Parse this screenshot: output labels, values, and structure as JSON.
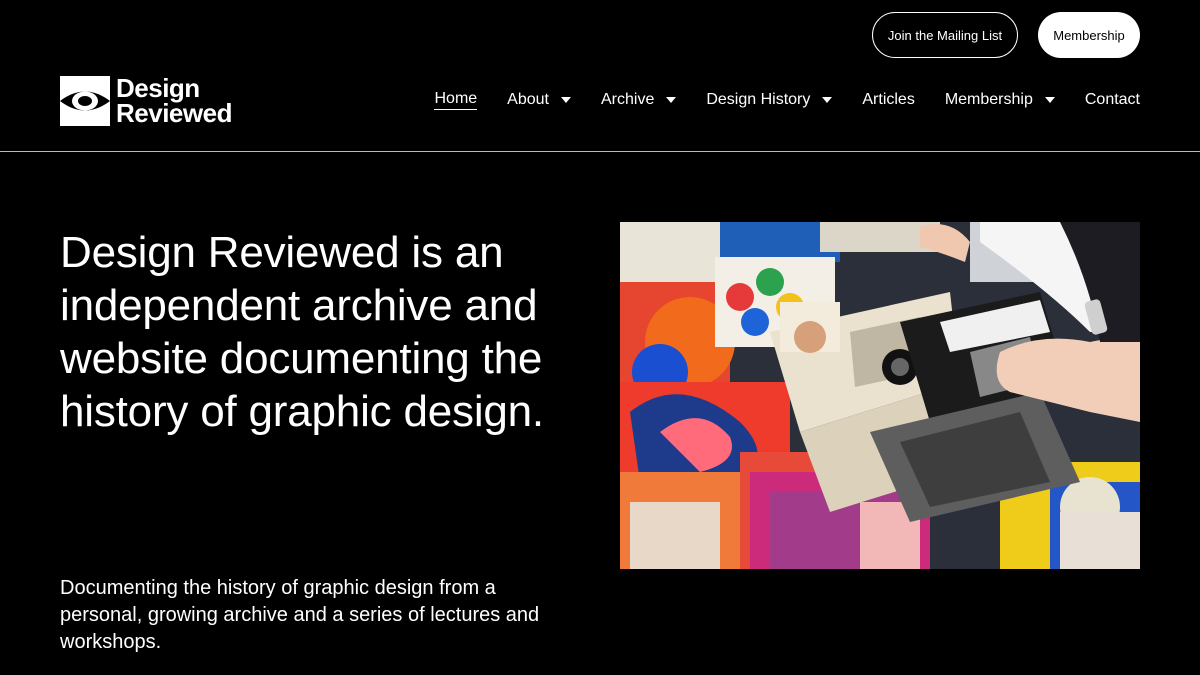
{
  "topbar": {
    "mailing_label": "Join the Mailing List",
    "membership_label": "Membership"
  },
  "logo": {
    "line1": "Design",
    "line2": "Reviewed",
    "icon": "eye-icon"
  },
  "nav": {
    "items": [
      {
        "label": "Home",
        "active": true,
        "has_dropdown": false
      },
      {
        "label": "About",
        "has_dropdown": true
      },
      {
        "label": "Archive",
        "has_dropdown": true
      },
      {
        "label": "Design History",
        "has_dropdown": true
      },
      {
        "label": "Articles",
        "has_dropdown": false
      },
      {
        "label": "Membership",
        "has_dropdown": true
      },
      {
        "label": "Contact",
        "has_dropdown": false
      }
    ],
    "dropdown_icon": "caret-down-icon"
  },
  "hero": {
    "title": "Design Reviewed is an independent archive and website documenting the history of graphic design.",
    "subtitle": "Documenting the history of graphic design from a personal, growing archive and a series of lectures and workshops."
  },
  "colors": {
    "background": "#000000",
    "text": "#ffffff",
    "divider": "#bbbbbb"
  }
}
